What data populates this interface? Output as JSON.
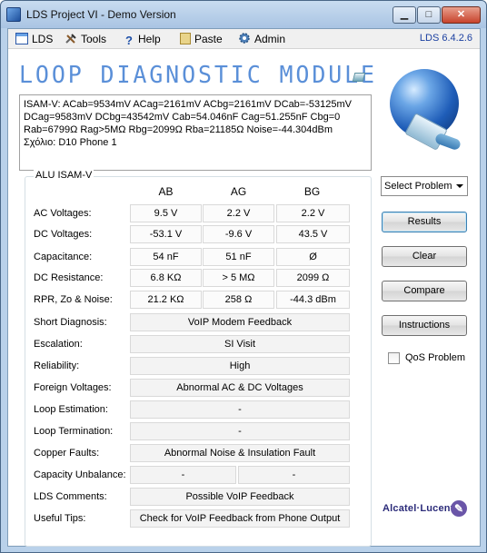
{
  "window": {
    "title": "LDS Project VI - Demo Version",
    "min_glyph": "▁",
    "max_glyph": "□",
    "close_glyph": "✕"
  },
  "menu": {
    "items": [
      {
        "label": "LDS",
        "icon": "window-icon"
      },
      {
        "label": "Tools",
        "icon": "tools-icon"
      },
      {
        "label": "Help",
        "icon": "question-icon"
      },
      {
        "label": "Paste",
        "icon": "clipboard-icon"
      },
      {
        "label": "Admin",
        "icon": "gear-icon"
      }
    ],
    "version": "LDS 6.4.2.6"
  },
  "header": {
    "module_title": "LOOP DIAGNOSTIC MODULE",
    "isam_text": "ISAM-V: ACab=9534mV ACag=2161mV ACbg=2161mV DCab=-53125mV DCag=9583mV DCbg=43542mV Cab=54.046nF Cag=51.255nF Cbg=0 Rab=6799Ω Rag>5MΩ Rbg=2099Ω Rba=21185Ω Noise=-44.304dBm Σχόλιο: D10 Phone 1"
  },
  "group": {
    "label": "ALU ISAM-V",
    "columns": [
      "AB",
      "AG",
      "BG"
    ],
    "rows": [
      {
        "label": "AC Voltages:",
        "values": [
          "9.5 V",
          "2.2 V",
          "2.2 V"
        ]
      },
      {
        "label": "DC Voltages:",
        "values": [
          "-53.1 V",
          "-9.6 V",
          "43.5 V"
        ]
      },
      {
        "label": "Capacitance:",
        "values": [
          "54 nF",
          "51 nF",
          "Ø"
        ]
      },
      {
        "label": "DC Resistance:",
        "values": [
          "6.8 KΩ",
          "> 5 MΩ",
          "2099 Ω"
        ]
      },
      {
        "label": "RPR, Zo & Noise:",
        "values": [
          "21.2 KΩ",
          "258 Ω",
          "-44.3 dBm"
        ]
      }
    ],
    "diag": [
      {
        "label": "Short Diagnosis:",
        "value": "VoIP Modem Feedback"
      },
      {
        "label": "Escalation:",
        "value": "SI Visit"
      },
      {
        "label": "Reliability:",
        "value": "High"
      },
      {
        "label": "Foreign Voltages:",
        "value": "Abnormal AC & DC Voltages"
      },
      {
        "label": "Loop Estimation:",
        "value": "-"
      },
      {
        "label": "Loop Termination:",
        "value": "-"
      },
      {
        "label": "Copper Faults:",
        "value": "Abnormal Noise & Insulation Fault"
      }
    ],
    "capacity": {
      "label": "Capacity Unbalance:",
      "left": "-",
      "right": "-"
    },
    "comments": {
      "label": "LDS Comments:",
      "value": "Possible VoIP Feedback"
    },
    "tips": {
      "label": "Useful Tips:",
      "value": "Check for VoIP Feedback from Phone Output"
    }
  },
  "side": {
    "select_problem": "Select Problem",
    "buttons": [
      "Results",
      "Clear",
      "Compare",
      "Instructions"
    ],
    "qos_label": "QoS Problem",
    "logo": "Alcatel·Lucent",
    "logo_mark": "✎"
  }
}
